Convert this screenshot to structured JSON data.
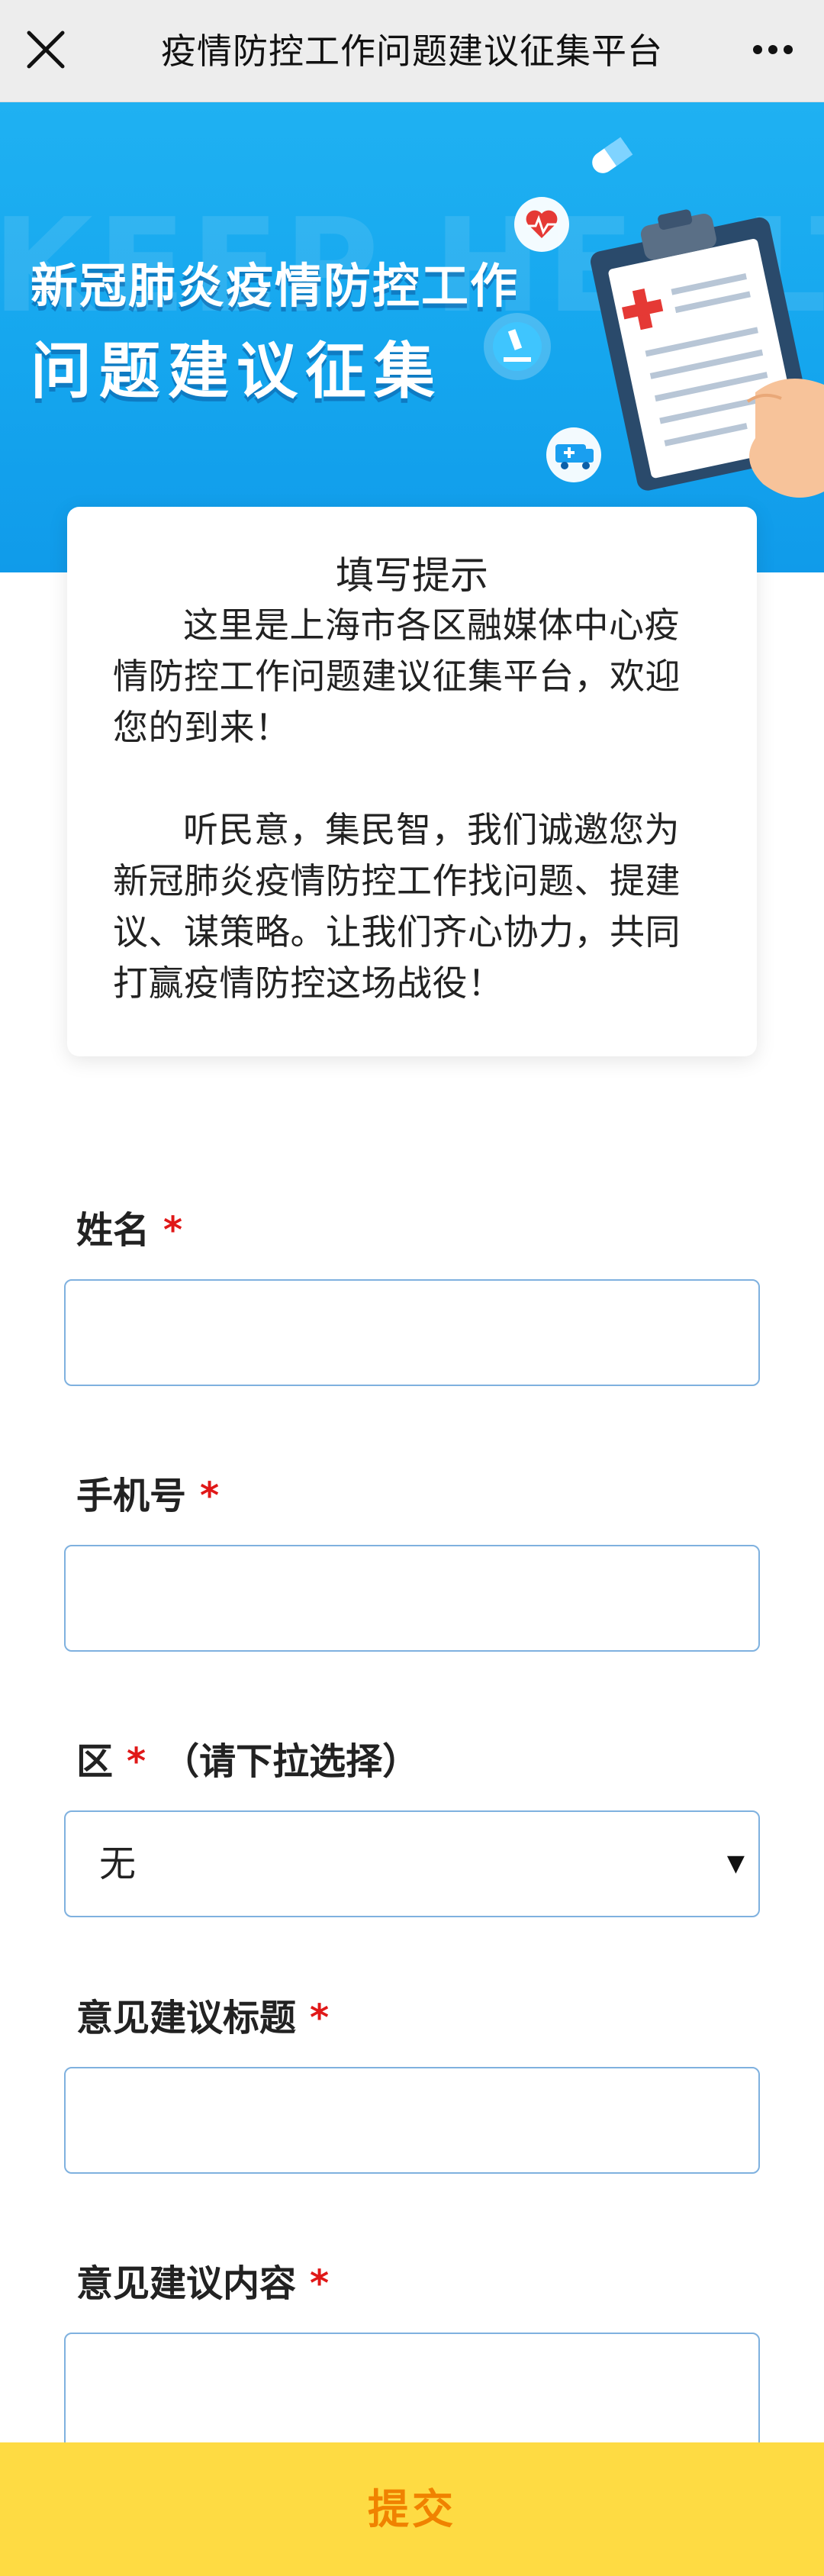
{
  "navbar": {
    "title": "疫情防控工作问题建议征集平台",
    "close_icon": "close-icon",
    "more_icon": "more-dots-icon"
  },
  "banner": {
    "line1": "新冠肺炎疫情防控工作",
    "line2": "问题建议征集",
    "watermark": "KEEP HEALTHY",
    "colors": {
      "background": "#15a6ee",
      "accent_red": "#e53935"
    }
  },
  "tip": {
    "title": "填写提示",
    "paragraph1": "这里是上海市各区融媒体中心疫情防控工作问题建议征集平台，欢迎您的到来！",
    "paragraph2": "听民意，集民智，我们诚邀您为新冠肺炎疫情防控工作找问题、提建议、谋策略。让我们齐心协力，共同打赢疫情防控这场战役！"
  },
  "form": {
    "required_mark": "*",
    "name_label": "姓名",
    "phone_label": "手机号",
    "district_label": "区",
    "district_hint": "（请下拉选择）",
    "district_value": "无",
    "title_label": "意见建议标题",
    "content_label": "意见建议内容"
  },
  "submit": {
    "label": "提交",
    "colors": {
      "background": "#fedb43",
      "text": "#f08200"
    }
  }
}
